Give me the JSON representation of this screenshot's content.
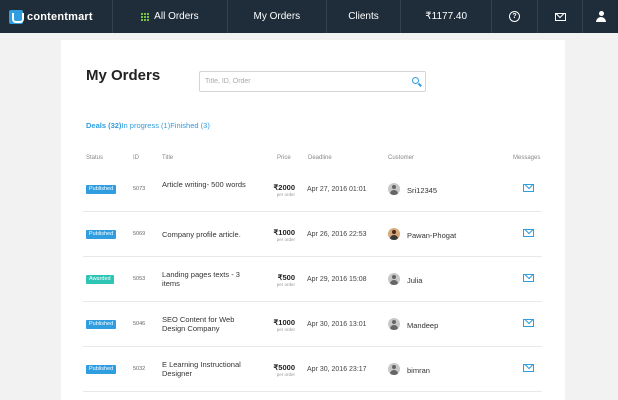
{
  "brand": {
    "name": "contentmart"
  },
  "nav": {
    "all_orders": "All Orders",
    "my_orders": "My Orders",
    "clients": "Clients",
    "balance": "₹1177.40",
    "help_icon": "?"
  },
  "page": {
    "title": "My Orders",
    "search_placeholder": "Title, ID, Order"
  },
  "filters": [
    {
      "label": "Deals (32)"
    },
    {
      "label": "In progress (1)"
    },
    {
      "label": "Finished (3)"
    }
  ],
  "columns": {
    "status": "Status",
    "id": "ID",
    "title": "Title",
    "price": "Price",
    "deadline": "Deadline",
    "customer": "Customer",
    "messages": "Messages"
  },
  "orders": [
    {
      "status": "Published",
      "id": "5073",
      "title": "Article writing- 500 words",
      "price": "₹2000",
      "price_note": "per order",
      "deadline": "Apr 27, 2016 01:01",
      "customer": "Sri12345"
    },
    {
      "status": "Published",
      "id": "5069",
      "title": "Company profile article.",
      "price": "₹1000",
      "price_note": "per order",
      "deadline": "Apr 26, 2016 22:53",
      "customer": "Pawan-Phogat"
    },
    {
      "status": "Awarded",
      "id": "5053",
      "title": "Landing pages texts - 3 items",
      "price": "₹500",
      "price_note": "per order",
      "deadline": "Apr 29, 2016 15:08",
      "customer": "Julia"
    },
    {
      "status": "Published",
      "id": "5046",
      "title": "SEO Content for Web Design Company",
      "price": "₹1000",
      "price_note": "per order",
      "deadline": "Apr 30, 2016 13:01",
      "customer": "Mandeep"
    },
    {
      "status": "Published",
      "id": "5032",
      "title": "E Learning Instructional Designer",
      "price": "₹5000",
      "price_note": "per order",
      "deadline": "Apr 30, 2016 23:17",
      "customer": "bimran"
    }
  ],
  "colors": {
    "nav_bg": "#1f2d3a",
    "accent": "#2f9de0",
    "awarded": "#2ec4b6",
    "grid_icon": "#79c142"
  }
}
